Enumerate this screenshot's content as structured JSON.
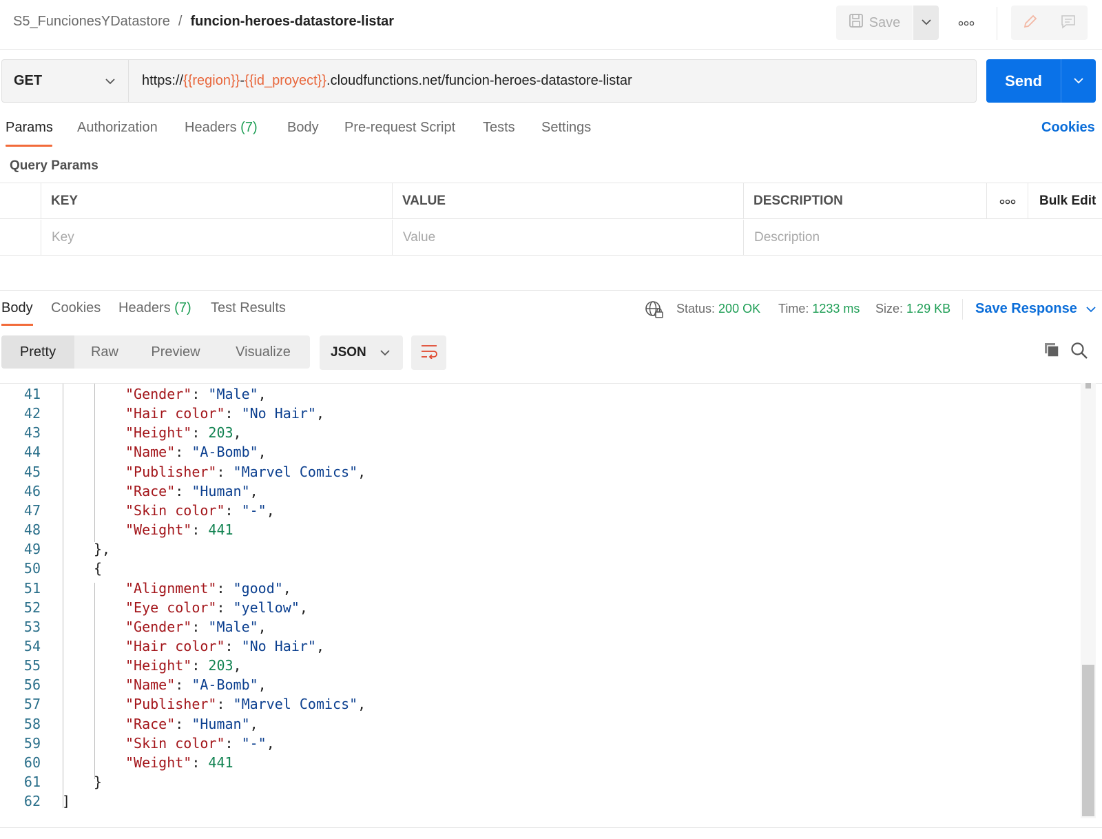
{
  "header": {
    "collection": "S5_FuncionesYDatastore",
    "separator": "/",
    "request_name": "funcion-heroes-datastore-listar",
    "save_label": "Save"
  },
  "request": {
    "method": "GET",
    "url_parts": [
      {
        "text": "https://",
        "type": "plain"
      },
      {
        "text": "{{region}}",
        "type": "var"
      },
      {
        "text": "-",
        "type": "plain"
      },
      {
        "text": "{{id_proyect}}",
        "type": "var"
      },
      {
        "text": ".cloudfunctions.net/funcion-heroes-datastore-listar",
        "type": "plain"
      }
    ],
    "send_label": "Send"
  },
  "tabs": {
    "params": "Params",
    "authorization": "Authorization",
    "headers": "Headers",
    "headers_count": "(7)",
    "body": "Body",
    "prerequest": "Pre-request Script",
    "tests": "Tests",
    "settings": "Settings",
    "cookies": "Cookies"
  },
  "query_params": {
    "title": "Query Params",
    "columns": [
      "KEY",
      "VALUE",
      "DESCRIPTION"
    ],
    "bulk_edit": "Bulk Edit",
    "placeholders": [
      "Key",
      "Value",
      "Description"
    ]
  },
  "response": {
    "tabs": {
      "body": "Body",
      "cookies": "Cookies",
      "headers": "Headers",
      "headers_count": "(7)",
      "test_results": "Test Results"
    },
    "status_label": "Status:",
    "status_value": "200 OK",
    "time_label": "Time:",
    "time_value": "1233 ms",
    "size_label": "Size:",
    "size_value": "1.29 KB",
    "save_response": "Save Response",
    "formats": [
      "Pretty",
      "Raw",
      "Preview",
      "Visualize"
    ],
    "language": "JSON"
  },
  "code_lines": [
    {
      "n": "41",
      "indent": 2,
      "tokens": [
        [
          "k",
          "\"Gender\""
        ],
        [
          "p",
          ": "
        ],
        [
          "s",
          "\"Male\""
        ],
        [
          "p",
          ","
        ]
      ]
    },
    {
      "n": "42",
      "indent": 2,
      "tokens": [
        [
          "k",
          "\"Hair color\""
        ],
        [
          "p",
          ": "
        ],
        [
          "s",
          "\"No Hair\""
        ],
        [
          "p",
          ","
        ]
      ]
    },
    {
      "n": "43",
      "indent": 2,
      "tokens": [
        [
          "k",
          "\"Height\""
        ],
        [
          "p",
          ": "
        ],
        [
          "n",
          "203"
        ],
        [
          "p",
          ","
        ]
      ]
    },
    {
      "n": "44",
      "indent": 2,
      "tokens": [
        [
          "k",
          "\"Name\""
        ],
        [
          "p",
          ": "
        ],
        [
          "s",
          "\"A-Bomb\""
        ],
        [
          "p",
          ","
        ]
      ]
    },
    {
      "n": "45",
      "indent": 2,
      "tokens": [
        [
          "k",
          "\"Publisher\""
        ],
        [
          "p",
          ": "
        ],
        [
          "s",
          "\"Marvel Comics\""
        ],
        [
          "p",
          ","
        ]
      ]
    },
    {
      "n": "46",
      "indent": 2,
      "tokens": [
        [
          "k",
          "\"Race\""
        ],
        [
          "p",
          ": "
        ],
        [
          "s",
          "\"Human\""
        ],
        [
          "p",
          ","
        ]
      ]
    },
    {
      "n": "47",
      "indent": 2,
      "tokens": [
        [
          "k",
          "\"Skin color\""
        ],
        [
          "p",
          ": "
        ],
        [
          "s",
          "\"-\""
        ],
        [
          "p",
          ","
        ]
      ]
    },
    {
      "n": "48",
      "indent": 2,
      "tokens": [
        [
          "k",
          "\"Weight\""
        ],
        [
          "p",
          ": "
        ],
        [
          "n",
          "441"
        ]
      ]
    },
    {
      "n": "49",
      "indent": 1,
      "tokens": [
        [
          "p",
          "},"
        ]
      ]
    },
    {
      "n": "50",
      "indent": 1,
      "tokens": [
        [
          "p",
          "{"
        ]
      ]
    },
    {
      "n": "51",
      "indent": 2,
      "tokens": [
        [
          "k",
          "\"Alignment\""
        ],
        [
          "p",
          ": "
        ],
        [
          "s",
          "\"good\""
        ],
        [
          "p",
          ","
        ]
      ]
    },
    {
      "n": "52",
      "indent": 2,
      "tokens": [
        [
          "k",
          "\"Eye color\""
        ],
        [
          "p",
          ": "
        ],
        [
          "s",
          "\"yellow\""
        ],
        [
          "p",
          ","
        ]
      ]
    },
    {
      "n": "53",
      "indent": 2,
      "tokens": [
        [
          "k",
          "\"Gender\""
        ],
        [
          "p",
          ": "
        ],
        [
          "s",
          "\"Male\""
        ],
        [
          "p",
          ","
        ]
      ]
    },
    {
      "n": "54",
      "indent": 2,
      "tokens": [
        [
          "k",
          "\"Hair color\""
        ],
        [
          "p",
          ": "
        ],
        [
          "s",
          "\"No Hair\""
        ],
        [
          "p",
          ","
        ]
      ]
    },
    {
      "n": "55",
      "indent": 2,
      "tokens": [
        [
          "k",
          "\"Height\""
        ],
        [
          "p",
          ": "
        ],
        [
          "n",
          "203"
        ],
        [
          "p",
          ","
        ]
      ]
    },
    {
      "n": "56",
      "indent": 2,
      "tokens": [
        [
          "k",
          "\"Name\""
        ],
        [
          "p",
          ": "
        ],
        [
          "s",
          "\"A-Bomb\""
        ],
        [
          "p",
          ","
        ]
      ]
    },
    {
      "n": "57",
      "indent": 2,
      "tokens": [
        [
          "k",
          "\"Publisher\""
        ],
        [
          "p",
          ": "
        ],
        [
          "s",
          "\"Marvel Comics\""
        ],
        [
          "p",
          ","
        ]
      ]
    },
    {
      "n": "58",
      "indent": 2,
      "tokens": [
        [
          "k",
          "\"Race\""
        ],
        [
          "p",
          ": "
        ],
        [
          "s",
          "\"Human\""
        ],
        [
          "p",
          ","
        ]
      ]
    },
    {
      "n": "59",
      "indent": 2,
      "tokens": [
        [
          "k",
          "\"Skin color\""
        ],
        [
          "p",
          ": "
        ],
        [
          "s",
          "\"-\""
        ],
        [
          "p",
          ","
        ]
      ]
    },
    {
      "n": "60",
      "indent": 2,
      "tokens": [
        [
          "k",
          "\"Weight\""
        ],
        [
          "p",
          ": "
        ],
        [
          "n",
          "441"
        ]
      ]
    },
    {
      "n": "61",
      "indent": 1,
      "tokens": [
        [
          "p",
          "}"
        ]
      ]
    },
    {
      "n": "62",
      "indent": 0,
      "tokens": [
        [
          "p",
          "]"
        ]
      ]
    }
  ],
  "colors": {
    "accent": "#0a72e8",
    "tab_underline": "#f26b3a",
    "status_ok": "#1e9e55",
    "variable": "#e8663b",
    "json_key": "#a3151a",
    "json_string": "#0b3f8f",
    "json_number": "#108250"
  },
  "icons": [
    "save-icon",
    "chevron-down-icon",
    "more-icon",
    "edit-icon",
    "comment-icon",
    "globe-lock-icon",
    "wrap-lines-icon",
    "copy-icon",
    "search-icon"
  ]
}
